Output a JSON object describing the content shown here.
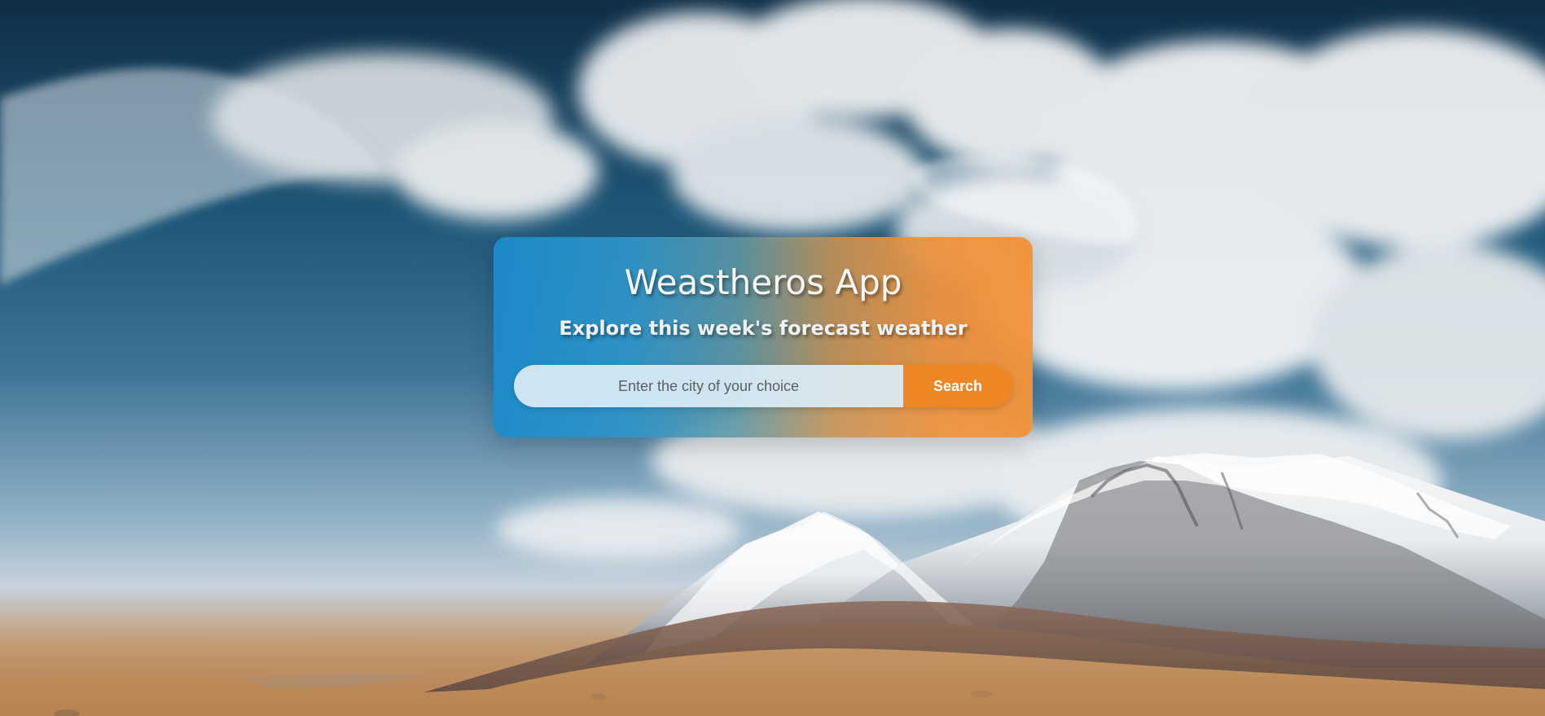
{
  "header": {
    "title": "Weastheros App",
    "subtitle": "Explore this week's forecast weather"
  },
  "search": {
    "value": "",
    "placeholder": "Enter the city of your choice",
    "button_label": "Search"
  },
  "colors": {
    "card_left": "#1b8ccb",
    "card_right": "#f29339",
    "button": "#ef8624",
    "input": "#dbecf5",
    "title_text": "#f6f6f6"
  }
}
